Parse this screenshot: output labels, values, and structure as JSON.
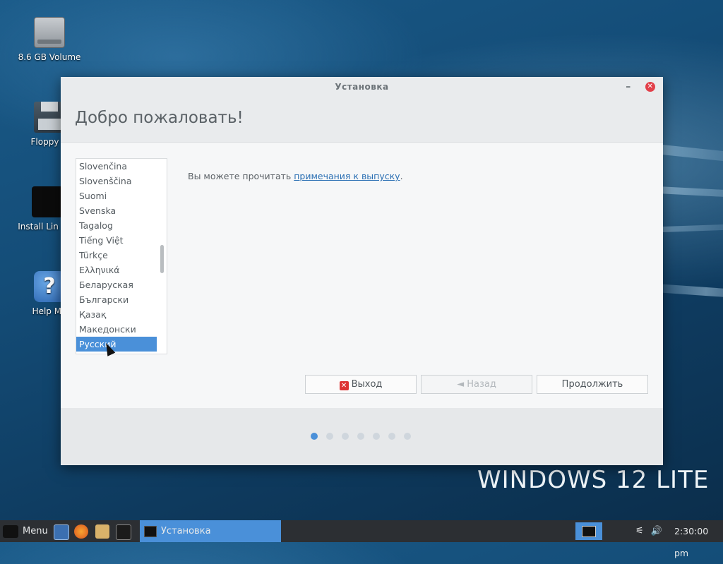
{
  "desktop": {
    "icons": [
      {
        "label": "8.6 GB Volume",
        "icon": "hard-drive-icon"
      },
      {
        "label": "Floppy D",
        "icon": "floppy-icon"
      },
      {
        "label": "Install Lin Lite",
        "icon": "linux-lite-icon"
      },
      {
        "label": "Help Ma",
        "icon": "help-icon"
      }
    ],
    "watermark": "WINDOWS 12 LITE"
  },
  "window": {
    "title": "Установка",
    "minimize_label": "–",
    "close_label": "✕",
    "heading": "Добро пожаловать!",
    "languages": [
      "Slovenčina",
      "Slovenščina",
      "Suomi",
      "Svenska",
      "Tagalog",
      "Tiếng Việt",
      "Türkçe",
      "Ελληνικά",
      "Беларуская",
      "Български",
      "Қазақ",
      "Македонски",
      "Русский"
    ],
    "selected_language": "Русский",
    "notes_text": "Вы можете прочитать ",
    "notes_link": "примечания к выпуску",
    "notes_end": ".",
    "buttons": {
      "exit": "Выход",
      "back": "◄ Назад",
      "continue": "Продолжить"
    },
    "progress": {
      "steps": 7,
      "current": 1
    }
  },
  "taskbar": {
    "menu_label": "Menu",
    "task_label": "Установка",
    "clock": "2:30:00 pm"
  },
  "colors": {
    "accent": "#4a90d9",
    "taskbar": "#2c2f33"
  }
}
